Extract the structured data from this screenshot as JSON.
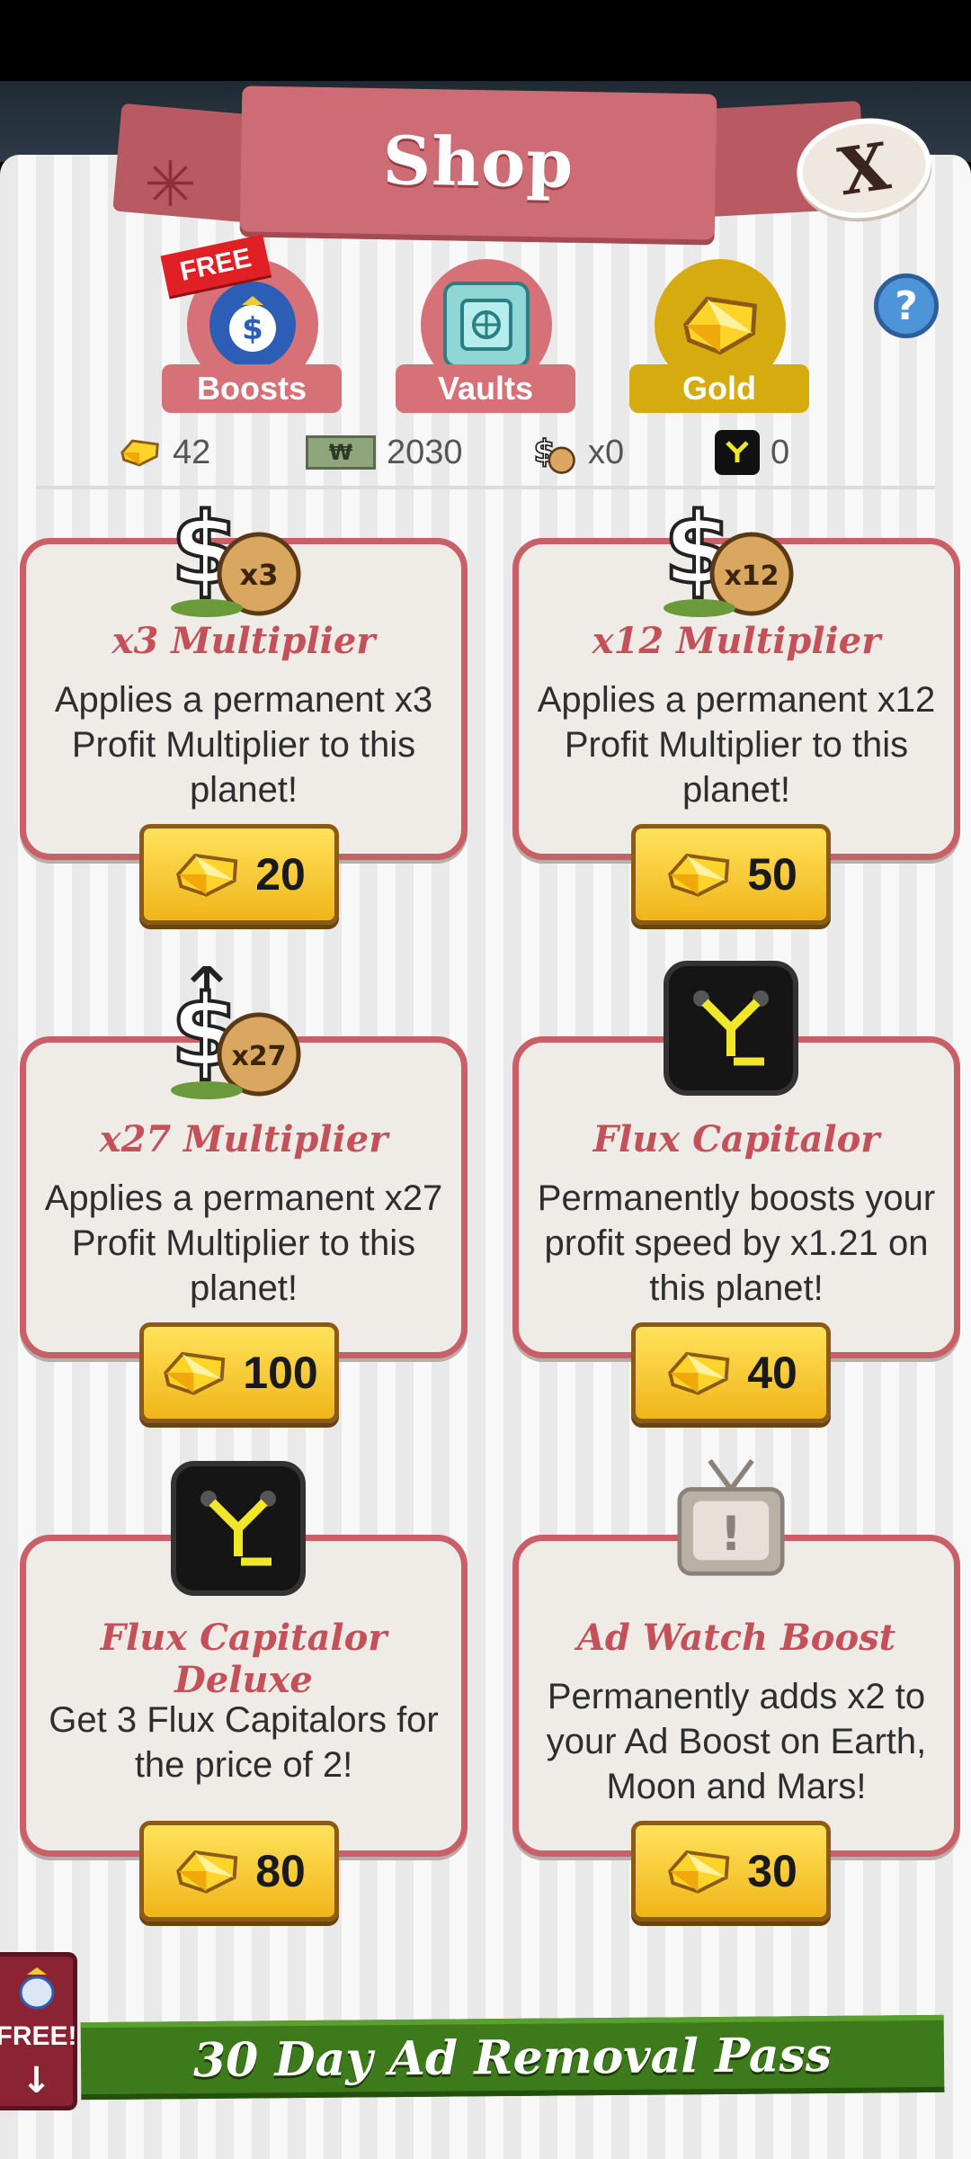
{
  "header": {
    "title": "Shop",
    "close_label": "X"
  },
  "tabs": [
    {
      "label": "Boosts",
      "badge": "FREE",
      "icon": "money-bag-boost-icon"
    },
    {
      "label": "Vaults",
      "icon": "vault-icon"
    },
    {
      "label": "Gold",
      "icon": "gold-gem-icon",
      "selected": true
    }
  ],
  "help_label": "?",
  "currencies": [
    {
      "icon": "gold-gem-icon",
      "value": "42"
    },
    {
      "icon": "cash-bill-icon",
      "value": "2030",
      "icon_text": "₩"
    },
    {
      "icon": "money-bag-icon",
      "value": "x0"
    },
    {
      "icon": "flux-capacitor-icon",
      "value": "0"
    }
  ],
  "cards": [
    {
      "title": "x3 Multiplier",
      "description": "Applies a permanent x3 Profit Multiplier to this planet!",
      "price": "20",
      "icon": "money-bag-x3-icon",
      "icon_text": "x3"
    },
    {
      "title": "x12 Multiplier",
      "description": "Applies a permanent x12 Profit Multiplier to this planet!",
      "price": "50",
      "icon": "money-bag-x12-icon",
      "icon_text": "x12"
    },
    {
      "title": "x27 Multiplier",
      "description": "Applies a permanent x27 Profit Multiplier to this planet!",
      "price": "100",
      "icon": "money-bag-x27-icon",
      "icon_text": "x27"
    },
    {
      "title": "Flux Capitalor",
      "description": "Permanently boosts your profit speed by x1.21 on this planet!",
      "price": "40",
      "icon": "flux-capacitor-icon"
    },
    {
      "title": "Flux Capitalor Deluxe",
      "description": "Get 3 Flux Capitalors for the price of 2!",
      "price": "80",
      "icon": "flux-capacitor-icon"
    },
    {
      "title": "Ad Watch Boost",
      "description": "Permanently adds x2 to your Ad Boost on Earth, Moon and Mars!",
      "price": "30",
      "icon": "tv-icon"
    }
  ],
  "footer": {
    "ad_pass_label": "30 Day Ad Removal Pass",
    "free_label": "FREE!"
  },
  "colors": {
    "accent_pink": "#cd6c74",
    "gold": "#d6ab10",
    "price_button": "#f0b51a",
    "ad_pass_green": "#3c7a1c"
  }
}
